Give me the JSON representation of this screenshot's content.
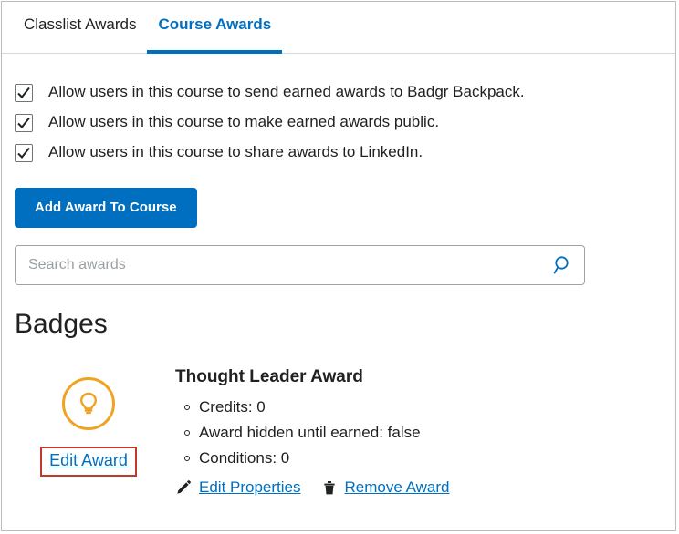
{
  "tabs": [
    {
      "label": "Classlist Awards",
      "active": false
    },
    {
      "label": "Course Awards",
      "active": true
    }
  ],
  "options": [
    {
      "label": "Allow users in this course to send earned awards to Badgr Backpack.",
      "checked": true
    },
    {
      "label": "Allow users in this course to make earned awards public.",
      "checked": true
    },
    {
      "label": "Allow users in this course to share awards to LinkedIn.",
      "checked": true
    }
  ],
  "toolbar": {
    "add_award_label": "Add Award To Course"
  },
  "search": {
    "placeholder": "Search awards",
    "value": "",
    "icon": "search-icon"
  },
  "section": {
    "title": "Badges"
  },
  "award": {
    "icon": "lightbulb-icon",
    "edit_award_label": "Edit Award",
    "title": "Thought Leader Award",
    "facts": [
      "Credits: 0",
      "Award hidden until earned: false",
      "Conditions: 0"
    ],
    "actions": [
      {
        "icon": "pencil-icon",
        "label": "Edit Properties"
      },
      {
        "icon": "trash-icon",
        "label": "Remove Award"
      }
    ]
  },
  "colors": {
    "accent": "#006fbf",
    "badge": "#f0a323",
    "highlight": "#c0392b"
  }
}
